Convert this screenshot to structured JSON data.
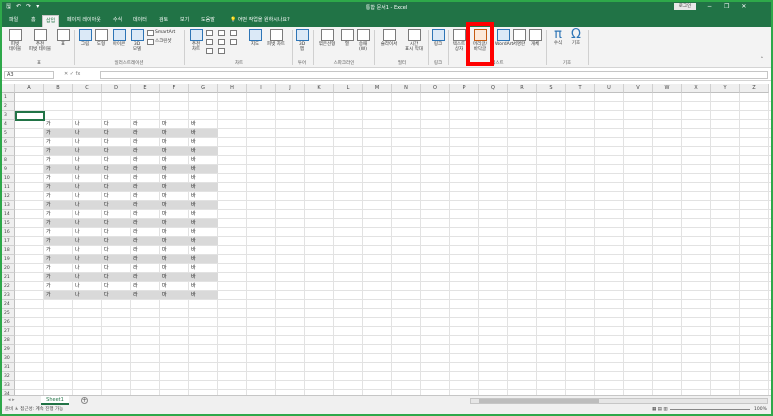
{
  "titlebar": {
    "doc_title": "통합 문서1  -  Excel",
    "login": "로그인",
    "qat_icons": [
      "save-icon",
      "undo-icon",
      "redo-icon",
      "customize-icon"
    ],
    "minimize": "−",
    "restore": "❐",
    "close": "✕"
  },
  "tabs": [
    {
      "label": "파일"
    },
    {
      "label": "홈"
    },
    {
      "label": "삽입"
    },
    {
      "label": "페이지 레이아웃"
    },
    {
      "label": "수식"
    },
    {
      "label": "데이터"
    },
    {
      "label": "검토"
    },
    {
      "label": "보기"
    },
    {
      "label": "도움말"
    }
  ],
  "tellme": "어떤 작업을 원하시나요?",
  "ribbon": {
    "pivot": "피벗\n테이블",
    "recommended_pivot": "추천\n피벗 테이블",
    "table": "표",
    "pictures": "그림",
    "shapes": "도형",
    "icons": "아이콘",
    "models3d": "3D\n모델",
    "smartart": "SmartArt",
    "screenshot": "스크린샷",
    "rec_charts": "추천\n차트",
    "maps": "지도",
    "pivotchart": "피벗 차트",
    "map3d": "3D\n맵",
    "line": "꺾은선형",
    "column": "열",
    "winloss": "승패\n(W)",
    "slicer": "슬라이서",
    "timeline": "시간\n표시 막대",
    "link": "링크",
    "textbox": "텍스트\n상자",
    "header_footer": "머리글/\n바닥글",
    "wordart": "WordArt",
    "signature": "서명란",
    "object": "개체",
    "equation": "수식",
    "symbol": "기호",
    "groups": {
      "tables": "표",
      "illustrations": "일러스트레이션",
      "charts": "차트",
      "tours": "투어",
      "sparklines": "스파크라인",
      "filters": "필터",
      "links": "링크",
      "text": "텍스트",
      "symbols": "기호"
    }
  },
  "formula_bar": {
    "namebox": "A3",
    "fx": "fx",
    "value": ""
  },
  "columns": [
    "A",
    "B",
    "C",
    "D",
    "E",
    "F",
    "G",
    "H",
    "I",
    "J",
    "K",
    "L",
    "M",
    "N",
    "O",
    "P",
    "Q",
    "R",
    "S",
    "T",
    "U",
    "V",
    "W",
    "X",
    "Y",
    "Z"
  ],
  "row_count": 34,
  "data_start_row": 4,
  "data_values": [
    "가",
    "나",
    "다",
    "라",
    "마",
    "바"
  ],
  "data_rows": 20,
  "sheet": {
    "name": "Sheet1",
    "add": "+"
  },
  "status": {
    "left": "준비    ♿ 접근성: 계속 진행 가능",
    "zoom_pct": "100%"
  }
}
